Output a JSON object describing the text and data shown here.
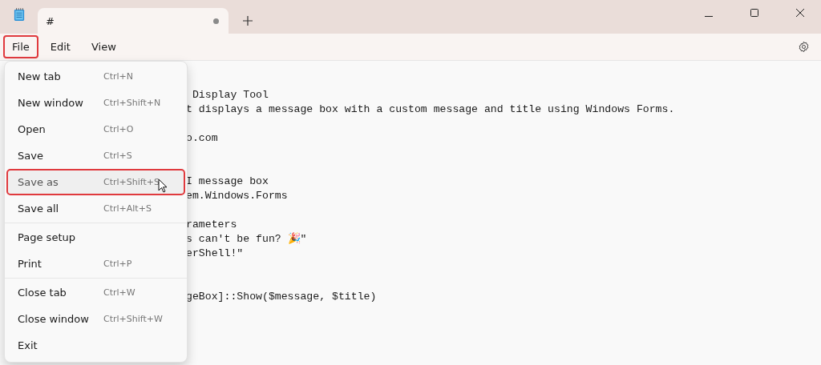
{
  "tabs": [
    {
      "title": "#",
      "unsaved": true,
      "selected": true
    }
  ],
  "menu_bar": [
    {
      "label": "File",
      "highlighted": true
    },
    {
      "label": "Edit",
      "highlighted": false
    },
    {
      "label": "View",
      "highlighted": false
    }
  ],
  "editor_blocks": [
    {
      "kind": "gap",
      "lines": [
        " Display Tool",
        "t displays a message box with a custom message and title using Windows Forms."
      ]
    },
    {
      "kind": "gap",
      "lines": [
        "o.com"
      ]
    },
    {
      "kind": "wide_gap",
      "lines": [
        "I message box",
        "em.Windows.Forms"
      ]
    },
    {
      "kind": "gap",
      "lines": [
        "rameters",
        "s can't be fun? 🎉\"",
        "erShell!\""
      ]
    },
    {
      "kind": "wide_gap",
      "lines": [
        "geBox]::Show($message, $title)"
      ]
    }
  ],
  "file_menu": {
    "groups": [
      [
        {
          "label": "New tab",
          "shortcut": "Ctrl+N",
          "selected": false,
          "highlighted": false
        },
        {
          "label": "New window",
          "shortcut": "Ctrl+Shift+N",
          "selected": false,
          "highlighted": false
        },
        {
          "label": "Open",
          "shortcut": "Ctrl+O",
          "selected": false,
          "highlighted": false
        },
        {
          "label": "Save",
          "shortcut": "Ctrl+S",
          "selected": false,
          "highlighted": false
        },
        {
          "label": "Save as",
          "shortcut": "Ctrl+Shift+S",
          "selected": true,
          "highlighted": true
        },
        {
          "label": "Save all",
          "shortcut": "Ctrl+Alt+S",
          "selected": false,
          "highlighted": false
        }
      ],
      [
        {
          "label": "Page setup",
          "selected": false,
          "highlighted": false
        },
        {
          "label": "Print",
          "shortcut": "Ctrl+P",
          "selected": false,
          "highlighted": false
        }
      ],
      [
        {
          "label": "Close tab",
          "shortcut": "Ctrl+W",
          "selected": false,
          "highlighted": false
        },
        {
          "label": "Close window",
          "shortcut": "Ctrl+Shift+W",
          "selected": false,
          "highlighted": false
        },
        {
          "label": "Exit",
          "selected": false,
          "highlighted": false
        }
      ]
    ]
  }
}
